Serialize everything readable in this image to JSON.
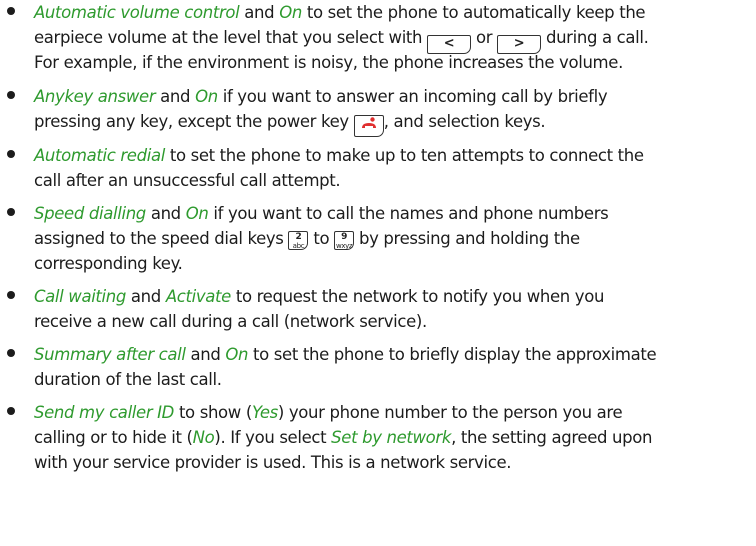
{
  "keys": {
    "left": "<",
    "right": ">",
    "k2_digit": "2",
    "k2_letters": "abc",
    "k9_digit": "9",
    "k9_letters": "wxyz"
  },
  "items": [
    {
      "term": "Automatic volume control",
      "t1": " and ",
      "value": "On",
      "t2": " to set the phone to automatically keep the",
      "t3": "earpiece volume at the level that you select with",
      "t4": " or ",
      "t5": " during a call.",
      "t6": "For example, if the environment is noisy, the phone increases the volume."
    },
    {
      "term": "Anykey answer",
      "t1": " and ",
      "value": "On",
      "t2": " if you want to answer an incoming call by briefly",
      "t3": "pressing any key, except the power key ",
      "t4": ", and selection keys."
    },
    {
      "term": "Automatic redial",
      "t1": " to set the phone to make up to ten attempts to connect the",
      "t2": "call after an unsuccessful call attempt."
    },
    {
      "term": "Speed dialling",
      "t1": " and ",
      "value": "On",
      "t2": " if you want to call the names and phone numbers",
      "t3": "assigned to the speed dial keys",
      "t4": " to ",
      "t5": " by pressing and holding the",
      "t6": "corresponding key."
    },
    {
      "term": "Call waiting",
      "t1": " and ",
      "value": "Activate",
      "t2": " to request the network to notify you when you",
      "t3": "receive a new call during a call (network service)."
    },
    {
      "term": "Summary after call",
      "t1": " and ",
      "value": "On",
      "t2": " to set the phone to briefly display the approximate",
      "t3": "duration of the last call."
    },
    {
      "term": "Send my caller ID",
      "t1": " to show (",
      "yes": "Yes",
      "t2": ") your phone number to the person you are",
      "t3": "calling or to hide it (",
      "no": "No",
      "t4": "). If you select ",
      "set_by_network": "Set by network",
      "t5": ", the setting agreed upon",
      "t6": "with your service provider is used. This is a network service."
    }
  ],
  "colors": {
    "option_text": "#2e9a2e",
    "body_text": "#1c1c1c",
    "power_key": "#e03030"
  }
}
